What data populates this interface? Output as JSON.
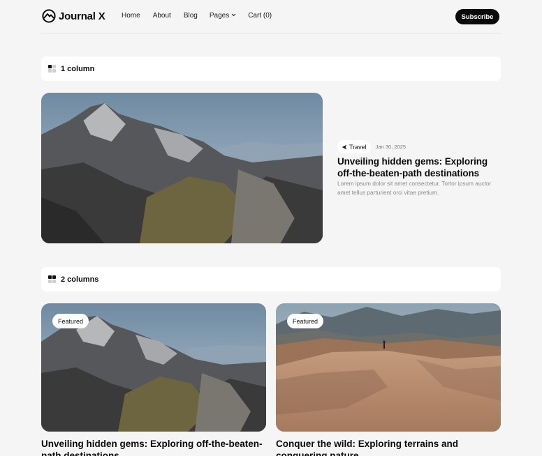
{
  "header": {
    "logo_text": "Journal X",
    "nav": [
      "Home",
      "About",
      "Blog",
      "Pages",
      "Cart (0)"
    ],
    "subscribe_label": "Subscribe"
  },
  "sections": {
    "one_column": "1 column",
    "two_columns": "2 columns"
  },
  "hero_post": {
    "tag": "Travel",
    "date": "Jan 30, 2025",
    "title": "Unveiling hidden gems: Exploring off-the-beaten-path destinations",
    "excerpt": "Lorem ipsum dolor sit amet consectetur. Tortor ipsum auctor amet tellus parturient orci vitae pretium."
  },
  "cards": [
    {
      "badge": "Featured",
      "title": "Unveiling hidden gems: Exploring off-the-beaten-path destinations"
    },
    {
      "badge": "Featured",
      "title": "Conquer the wild: Exploring terrains and conquering nature"
    }
  ],
  "colors": {
    "background": "#f5f5f5",
    "accent": "#0a0a0a",
    "surface": "#ffffff"
  }
}
